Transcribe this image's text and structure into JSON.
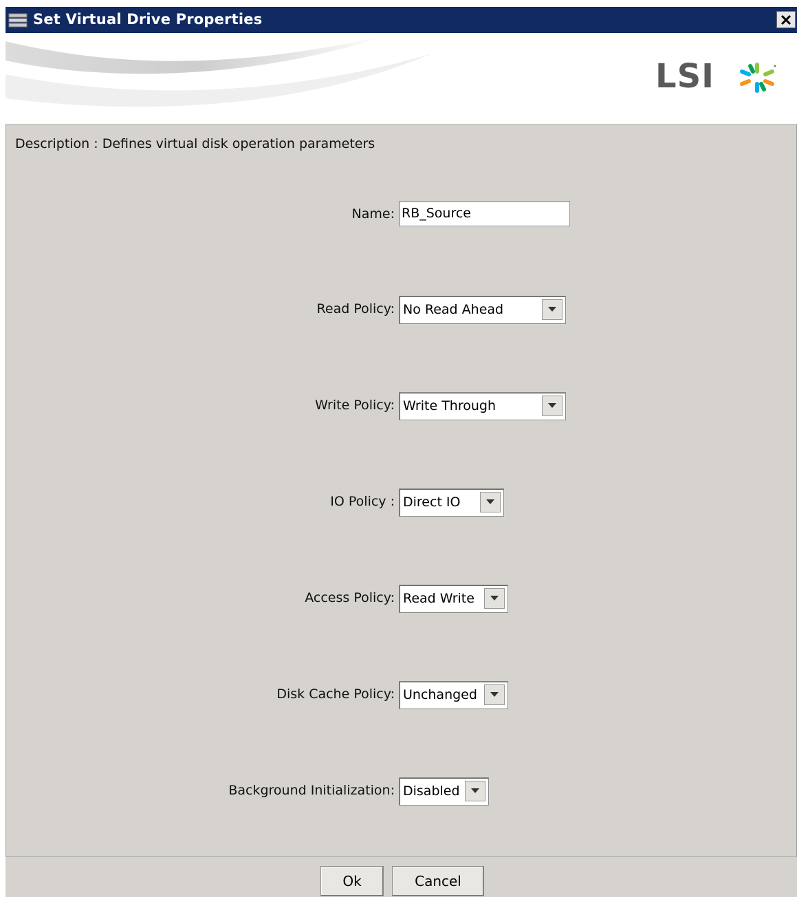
{
  "window": {
    "title": "Set Virtual Drive Properties"
  },
  "branding": {
    "logo_text": "LSI",
    "logo_mark_colors": [
      "#f7941d",
      "#8dc63f",
      "#00aeef",
      "#00a651"
    ]
  },
  "description": "Description : Defines virtual disk operation parameters",
  "fields": {
    "name": {
      "label": "Name:",
      "value": "RB_Source"
    },
    "read_policy": {
      "label": "Read Policy:",
      "value": "No Read Ahead"
    },
    "write_policy": {
      "label": "Write Policy:",
      "value": "Write Through"
    },
    "io_policy": {
      "label": "IO Policy :",
      "value": "Direct IO"
    },
    "access_policy": {
      "label": "Access Policy:",
      "value": "Read Write"
    },
    "disk_cache_policy": {
      "label": "Disk Cache Policy:",
      "value": "Unchanged"
    },
    "background_init": {
      "label": "Background Initialization:",
      "value": "Disabled"
    }
  },
  "buttons": {
    "ok": "Ok",
    "cancel": "Cancel"
  },
  "icons": {
    "window_icon": "drive-stack-icon",
    "close": "close-icon",
    "dropdown": "chevron-down-icon"
  },
  "colors": {
    "titlebar": "#122a62",
    "panel": "#d6d3ce"
  }
}
